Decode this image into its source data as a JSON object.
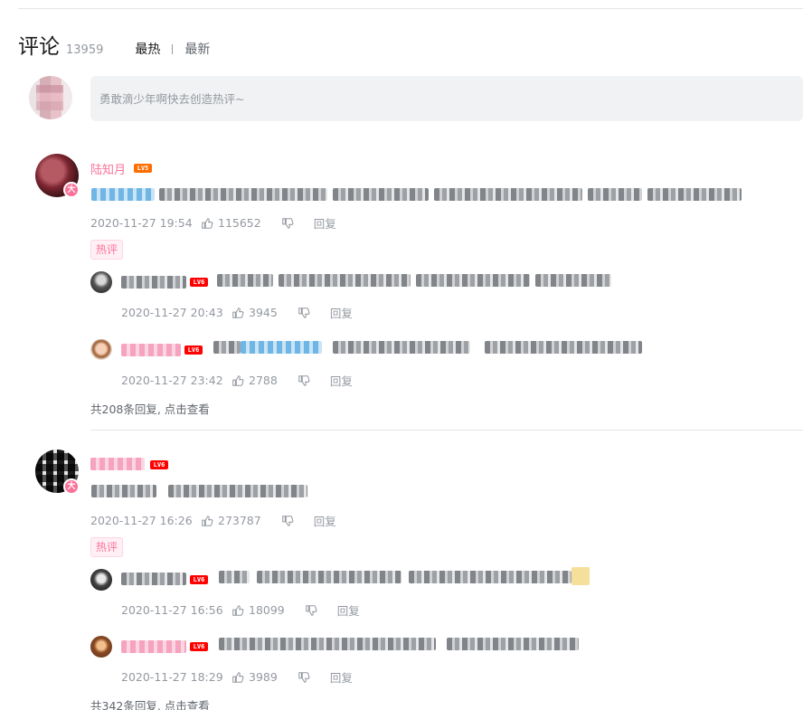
{
  "header": {
    "title": "评论",
    "count": "13959",
    "sort_hot": "最热",
    "sort_new": "最新"
  },
  "composer": {
    "placeholder": "勇敢滴少年啊快去创造热评~"
  },
  "comments": [
    {
      "username": "陆知月",
      "level": "LV5",
      "time": "2020-11-27 19:54",
      "likes": "115652",
      "reply_label": "回复",
      "hot_tag": "热评",
      "replies": [
        {
          "level": "LV6",
          "time": "2020-11-27 20:43",
          "likes": "3945",
          "reply_label": "回复"
        },
        {
          "level": "LV6",
          "time": "2020-11-27 23:42",
          "likes": "2788",
          "reply_label": "回复"
        }
      ],
      "view_more": "共208条回复, 点击查看"
    },
    {
      "level": "LV6",
      "time": "2020-11-27 16:26",
      "likes": "273787",
      "reply_label": "回复",
      "hot_tag": "热评",
      "replies": [
        {
          "level": "LV6",
          "time": "2020-11-27 16:56",
          "likes": "18099",
          "reply_label": "回复"
        },
        {
          "level": "LV6",
          "time": "2020-11-27 18:29",
          "likes": "3989",
          "reply_label": "回复"
        }
      ],
      "view_more": "共342条回复, 点击查看"
    }
  ],
  "badges": {
    "big_member": "大"
  },
  "colors": {
    "accent_pink": "#fb7299",
    "level_orange": "#ff6c00",
    "level_red": "#ff0000"
  },
  "icons": [
    "thumb-up-icon",
    "thumb-down-icon"
  ]
}
